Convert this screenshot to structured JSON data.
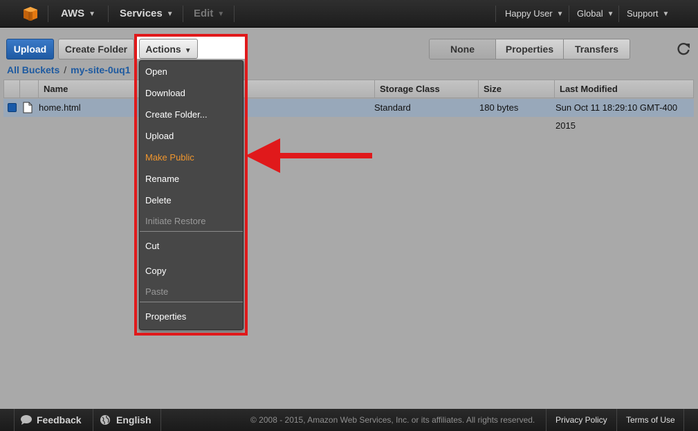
{
  "nav": {
    "brand": "AWS",
    "services": "Services",
    "edit": "Edit",
    "user": "Happy User",
    "region": "Global",
    "support": "Support"
  },
  "toolbar": {
    "upload": "Upload",
    "create_folder": "Create Folder",
    "actions": "Actions",
    "view_tabs": [
      "None",
      "Properties",
      "Transfers"
    ],
    "active_tab": "None"
  },
  "breadcrumb": {
    "root": "All Buckets",
    "bucket": "my-site-0uq1"
  },
  "table": {
    "columns": [
      "Name",
      "Storage Class",
      "Size",
      "Last Modified"
    ],
    "rows": [
      {
        "name": "home.html",
        "storage_class": "Standard",
        "size": "180 bytes",
        "last_modified": "Sun Oct 11 18:29:10 GMT-400 2015"
      }
    ]
  },
  "actions_menu": {
    "group1": [
      {
        "label": "Open",
        "state": "enabled"
      },
      {
        "label": "Download",
        "state": "enabled"
      },
      {
        "label": "Create Folder...",
        "state": "enabled"
      },
      {
        "label": "Upload",
        "state": "enabled"
      },
      {
        "label": "Make Public",
        "state": "highlighted"
      },
      {
        "label": "Rename",
        "state": "enabled"
      },
      {
        "label": "Delete",
        "state": "enabled"
      },
      {
        "label": "Initiate Restore",
        "state": "disabled"
      }
    ],
    "group2": [
      {
        "label": "Cut",
        "state": "enabled"
      },
      {
        "label": "Copy",
        "state": "enabled"
      },
      {
        "label": "Paste",
        "state": "disabled"
      }
    ],
    "group3": [
      {
        "label": "Properties",
        "state": "enabled"
      }
    ]
  },
  "footer": {
    "feedback": "Feedback",
    "language": "English",
    "copyright": "© 2008 - 2015, Amazon Web Services, Inc. or its affiliates. All rights reserved.",
    "privacy": "Privacy Policy",
    "terms": "Terms of Use"
  },
  "colors": {
    "annotation_red": "#e0191b",
    "highlight_item": "#f0962e",
    "link_blue": "#1e5aa0",
    "primary_button": "#1f5aa3"
  },
  "icons": {
    "logo": "aws-cube-icon",
    "refresh": "refresh-icon",
    "file": "file-icon",
    "feedback": "speech-bubble-icon",
    "language": "globe-icon"
  }
}
